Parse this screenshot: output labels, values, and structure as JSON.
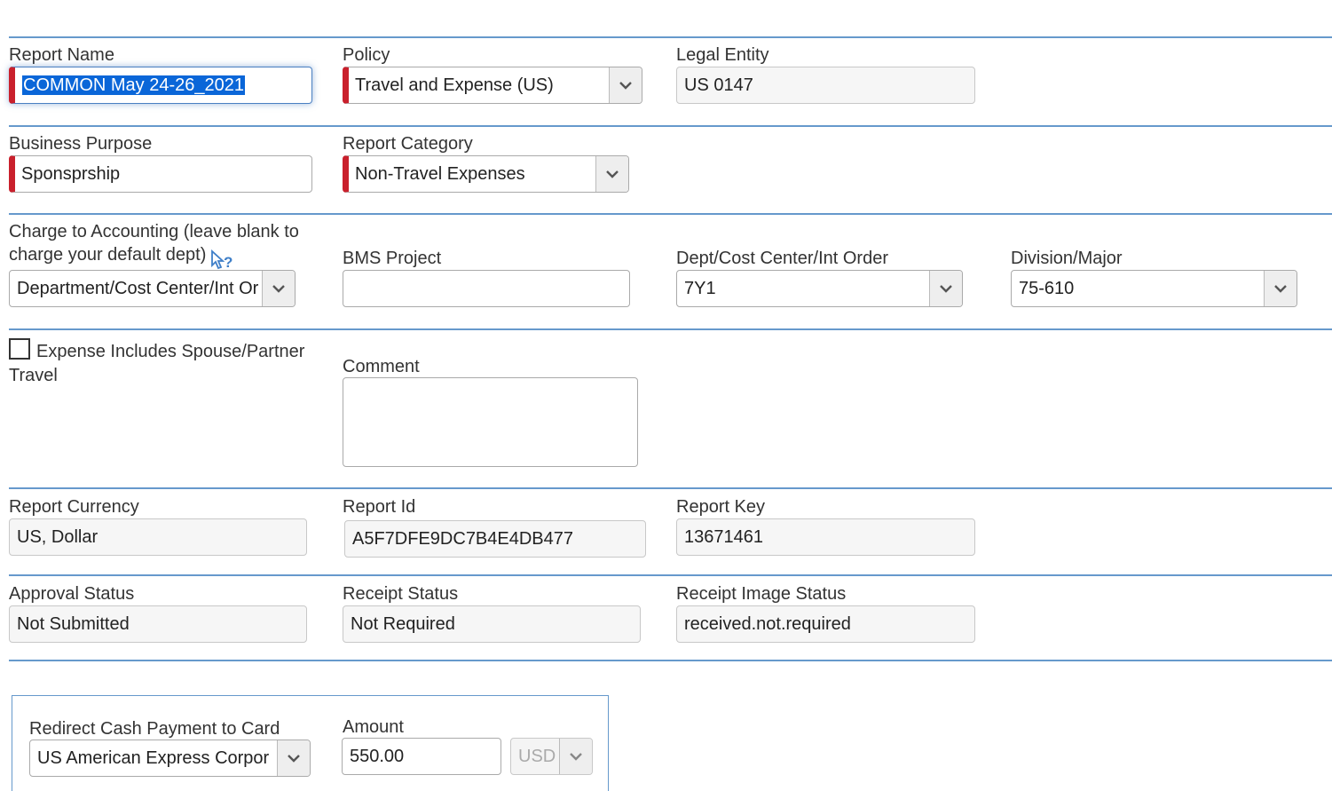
{
  "row1": {
    "report_name": {
      "label": "Report Name",
      "value": "COMMON May 24-26_2021"
    },
    "policy": {
      "label": "Policy",
      "value": "Travel and Expense (US)"
    },
    "legal_entity": {
      "label": "Legal Entity",
      "value": "US 0147"
    }
  },
  "row2": {
    "business_purpose": {
      "label": "Business Purpose",
      "value": "Sponsprship"
    },
    "report_category": {
      "label": "Report Category",
      "value": "Non-Travel Expenses"
    }
  },
  "row3": {
    "charge_to_accounting": {
      "label_line1": "Charge to Accounting (leave blank to",
      "label_line2": "charge your default dept)",
      "value": "Department/Cost Center/Int Or",
      "help_icon": "help-cursor-icon"
    },
    "bms_project": {
      "label": "BMS Project",
      "value": ""
    },
    "dept_cost_center": {
      "label": "Dept/Cost Center/Int Order",
      "value": "7Y1"
    },
    "division_major": {
      "label": "Division/Major",
      "value": "75-610"
    }
  },
  "row4": {
    "spouse_travel": {
      "label_line1": "Expense Includes Spouse/Partner",
      "label_line2": "Travel",
      "checked": false
    },
    "comment": {
      "label": "Comment",
      "value": ""
    }
  },
  "row5": {
    "report_currency": {
      "label": "Report Currency",
      "value": "US, Dollar"
    },
    "report_id": {
      "label": "Report Id",
      "value": "A5F7DFE9DC7B4E4DB477"
    },
    "report_key": {
      "label": "Report Key",
      "value": "13671461"
    }
  },
  "row6": {
    "approval_status": {
      "label": "Approval Status",
      "value": "Not Submitted"
    },
    "receipt_status": {
      "label": "Receipt Status",
      "value": "Not Required"
    },
    "receipt_image_status": {
      "label": "Receipt Image Status",
      "value": "received.not.required"
    }
  },
  "redirect": {
    "card": {
      "label": "Redirect Cash Payment to Card",
      "value": "US American Express Corpor"
    },
    "amount": {
      "label": "Amount",
      "value": "550.00",
      "currency": "USD"
    }
  },
  "colors": {
    "separator": "#6699cc",
    "required": "#c9202c",
    "selection": "#0a66d8"
  }
}
